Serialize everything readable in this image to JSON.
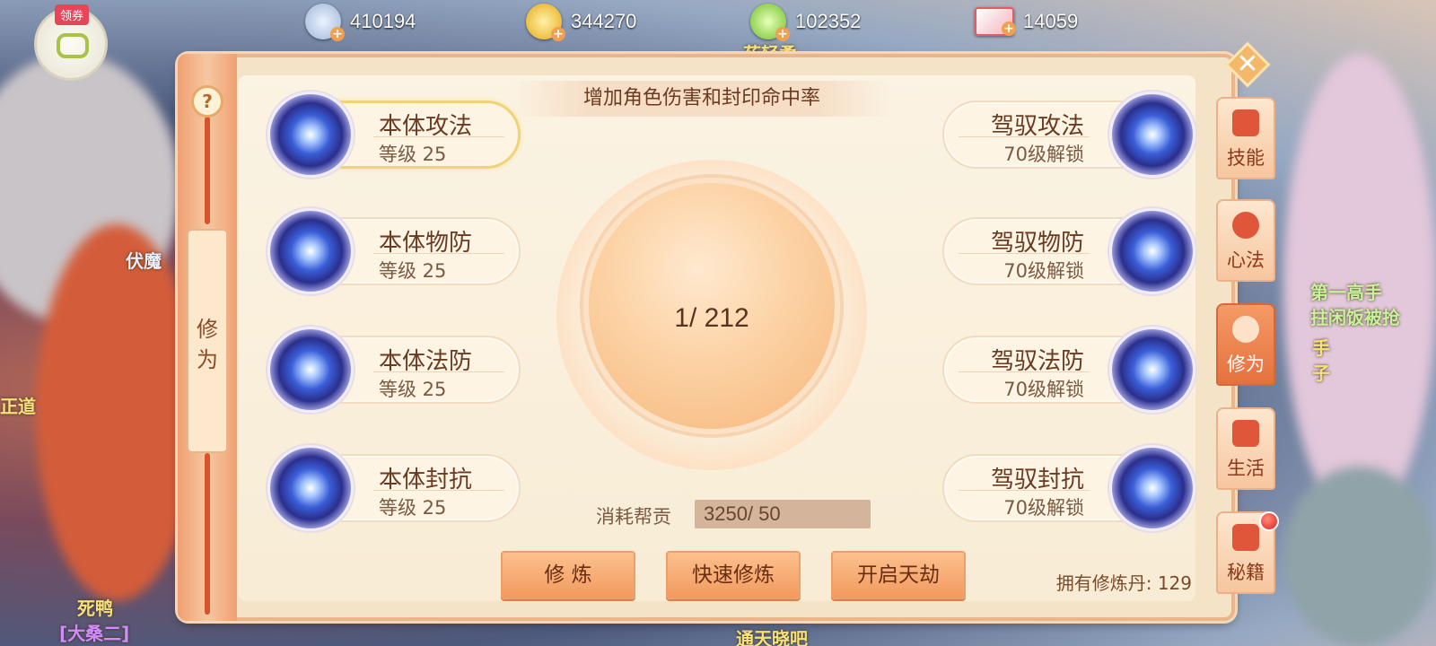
{
  "hud": {
    "voucher_label": "领券",
    "currencies": [
      {
        "icon": "silver-coin-icon",
        "value": "410194",
        "color": "#b9cde6"
      },
      {
        "icon": "gold-coin-icon",
        "value": "344270",
        "color": "#f5c233"
      },
      {
        "icon": "jade-coin-icon",
        "value": "102352",
        "color": "#8fd04a"
      },
      {
        "icon": "ticket-icon",
        "value": "14059",
        "color": "#e65a66"
      }
    ]
  },
  "background_texts": {
    "top_name": "莜轻柔",
    "left_mid": "伏魔",
    "right_1": "第一高手",
    "right_2": "拄闲饭被抢",
    "right_3": "手",
    "right_4": "子",
    "left_label": "正道",
    "bottom_left": "死鸭",
    "bottom_left_tag": "[大桑二]",
    "bottom_center": "通天晓吧"
  },
  "panel": {
    "help_label": "?",
    "side_title": "修为",
    "banner": "增加角色伤害和封印命中率",
    "left_skills": [
      {
        "name": "本体攻法",
        "sub": "等级 25"
      },
      {
        "name": "本体物防",
        "sub": "等级 25"
      },
      {
        "name": "本体法防",
        "sub": "等级 25"
      },
      {
        "name": "本体封抗",
        "sub": "等级 25"
      }
    ],
    "right_skills": [
      {
        "name": "驾驭攻法",
        "sub": "70级解锁"
      },
      {
        "name": "驾驭物防",
        "sub": "70级解锁"
      },
      {
        "name": "驾驭法防",
        "sub": "70级解锁"
      },
      {
        "name": "驾驭封抗",
        "sub": "70级解锁"
      }
    ],
    "progress_text": "1/ 212",
    "cost_label": "消耗帮贡",
    "cost_value": "3250/ 50",
    "buttons": [
      "修 炼",
      "快速修炼",
      "开启天劫"
    ],
    "owned_text": "拥有修炼丹: 129"
  },
  "tabs": [
    "技能",
    "心法",
    "修为",
    "生活",
    "秘籍"
  ],
  "active_tab": "修为"
}
